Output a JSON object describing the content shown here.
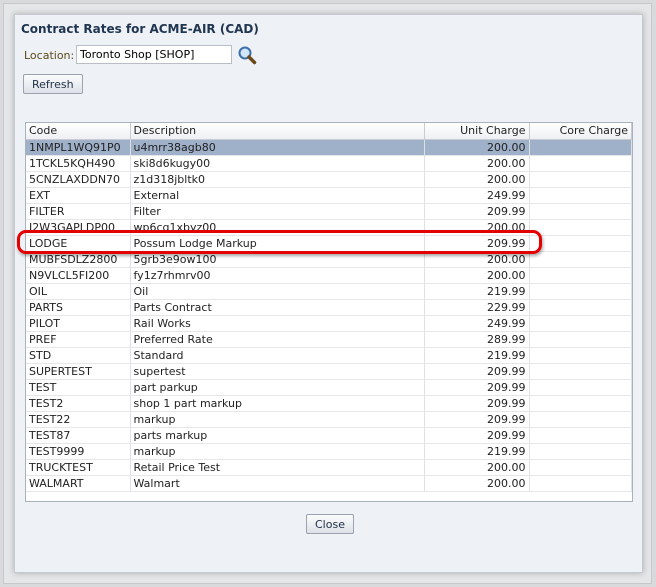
{
  "dialog": {
    "title": "Contract Rates for ACME-AIR (CAD)",
    "location_label": "Location:",
    "location_value": "Toronto Shop [SHOP]",
    "search_icon": "magnifier-icon",
    "refresh_label": "Refresh",
    "close_label": "Close"
  },
  "table": {
    "columns": [
      "Code",
      "Description",
      "Unit Charge",
      "Core Charge"
    ],
    "rows": [
      {
        "code": "1NMPL1WQ91P0",
        "desc": "u4mrr38agb80",
        "unit": "200.00",
        "core": "",
        "selected": true
      },
      {
        "code": "1TCKL5KQH490",
        "desc": "ski8d6kugy00",
        "unit": "200.00",
        "core": ""
      },
      {
        "code": "5CNZLAXDDN70",
        "desc": "z1d318jbltk0",
        "unit": "200.00",
        "core": ""
      },
      {
        "code": "EXT",
        "desc": "External",
        "unit": "249.99",
        "core": ""
      },
      {
        "code": "FILTER",
        "desc": "Filter",
        "unit": "209.99",
        "core": ""
      },
      {
        "code": "J2W3GAPLDP00",
        "desc": "wp6cq1xbyz00",
        "unit": "200.00",
        "core": ""
      },
      {
        "code": "LODGE",
        "desc": "Possum Lodge Markup",
        "unit": "209.99",
        "core": "",
        "highlighted": true
      },
      {
        "code": "MUBFSDLZ2800",
        "desc": "5grb3e9ow100",
        "unit": "200.00",
        "core": ""
      },
      {
        "code": "N9VLCL5FI200",
        "desc": "fy1z7rhmrv00",
        "unit": "200.00",
        "core": ""
      },
      {
        "code": "OIL",
        "desc": "Oil",
        "unit": "219.99",
        "core": ""
      },
      {
        "code": "PARTS",
        "desc": "Parts Contract",
        "unit": "229.99",
        "core": ""
      },
      {
        "code": "PILOT",
        "desc": "Rail Works",
        "unit": "249.99",
        "core": ""
      },
      {
        "code": "PREF",
        "desc": "Preferred Rate",
        "unit": "289.99",
        "core": ""
      },
      {
        "code": "STD",
        "desc": "Standard",
        "unit": "219.99",
        "core": ""
      },
      {
        "code": "SUPERTEST",
        "desc": "supertest",
        "unit": "209.99",
        "core": ""
      },
      {
        "code": "TEST",
        "desc": "part parkup",
        "unit": "209.99",
        "core": ""
      },
      {
        "code": "TEST2",
        "desc": "shop 1 part markup",
        "unit": "209.99",
        "core": ""
      },
      {
        "code": "TEST22",
        "desc": "markup",
        "unit": "209.99",
        "core": ""
      },
      {
        "code": "TEST87",
        "desc": "parts markup",
        "unit": "209.99",
        "core": ""
      },
      {
        "code": "TEST9999",
        "desc": "markup",
        "unit": "219.99",
        "core": ""
      },
      {
        "code": "TRUCKTEST",
        "desc": "Retail Price Test",
        "unit": "200.00",
        "core": ""
      },
      {
        "code": "WALMART",
        "desc": "Walmart",
        "unit": "200.00",
        "core": ""
      }
    ]
  },
  "colors": {
    "selected_row": "#9fb0c9",
    "highlight": "#e30000"
  }
}
